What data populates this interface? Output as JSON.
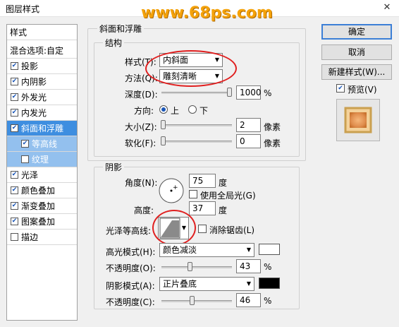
{
  "window": {
    "title": "图层样式",
    "close": "✕",
    "watermark": "www.68ps.com"
  },
  "left_panel": {
    "header": "样式",
    "blend": "混合选项:自定",
    "items": [
      {
        "label": "投影",
        "checked": true
      },
      {
        "label": "内阴影",
        "checked": true
      },
      {
        "label": "外发光",
        "checked": true
      },
      {
        "label": "内发光",
        "checked": true
      },
      {
        "label": "斜面和浮雕",
        "checked": true
      },
      {
        "label": "等高线",
        "checked": true
      },
      {
        "label": "纹理",
        "checked": false
      },
      {
        "label": "光泽",
        "checked": true
      },
      {
        "label": "颜色叠加",
        "checked": true
      },
      {
        "label": "渐变叠加",
        "checked": true
      },
      {
        "label": "图案叠加",
        "checked": true
      },
      {
        "label": "描边",
        "checked": false
      }
    ]
  },
  "bevel": {
    "group_title": "斜面和浮雕",
    "structure_title": "结构",
    "style_label": "样式(T):",
    "style_value": "内斜面",
    "technique_label": "方法(Q):",
    "technique_value": "雕刻清晰",
    "depth_label": "深度(D):",
    "depth_value": "1000",
    "depth_unit": "%",
    "depth_level": 1.0,
    "direction_label": "方向:",
    "direction_up": "上",
    "direction_down": "下",
    "size_label": "大小(Z):",
    "size_value": "2",
    "size_unit": "像素",
    "soften_label": "软化(F):",
    "soften_value": "0",
    "soften_unit": "像素"
  },
  "shading": {
    "title": "阴影",
    "angle_label": "角度(N):",
    "angle_value": "75",
    "angle_unit": "度",
    "global_light_label": "使用全局光(G)",
    "altitude_label": "高度:",
    "altitude_value": "37",
    "altitude_unit": "度",
    "gloss_label": "光泽等高线:",
    "antialias_label": "消除锯齿(L)",
    "highlight_mode_label": "高光模式(H):",
    "highlight_mode_value": "颜色减淡",
    "highlight_color": "#ffffff",
    "highlight_opacity_label": "不透明度(O):",
    "highlight_opacity_value": "43",
    "shadow_mode_label": "阴影模式(A):",
    "shadow_mode_value": "正片叠底",
    "shadow_color": "#000000",
    "shadow_opacity_label": "不透明度(C):",
    "shadow_opacity_value": "46",
    "percent": "%"
  },
  "buttons": {
    "ok": "确定",
    "cancel": "取消",
    "new_style": "新建样式(W)...",
    "preview": "预览(V)"
  }
}
